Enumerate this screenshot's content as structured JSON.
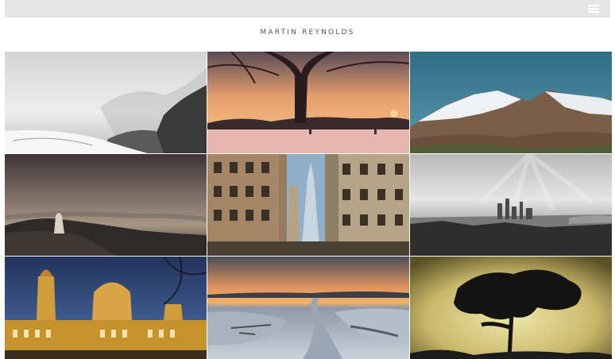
{
  "site": {
    "title": "MARTIN REYNOLDS"
  },
  "nav": {
    "menu_icon": "hamburger-menu-icon"
  },
  "colors": {
    "topbar": "#e6e6e6",
    "background": "#ffffff",
    "title_text": "#555555"
  },
  "gallery": {
    "items": [
      {
        "id": "coastal-mist"
      },
      {
        "id": "winter-bench-sunset"
      },
      {
        "id": "snowy-mountains"
      },
      {
        "id": "figure-on-ridge"
      },
      {
        "id": "skyscraper-street"
      },
      {
        "id": "city-skyline-mono"
      },
      {
        "id": "domed-building-night"
      },
      {
        "id": "frosty-river-dawn"
      },
      {
        "id": "tree-silhouette-gold"
      }
    ]
  }
}
